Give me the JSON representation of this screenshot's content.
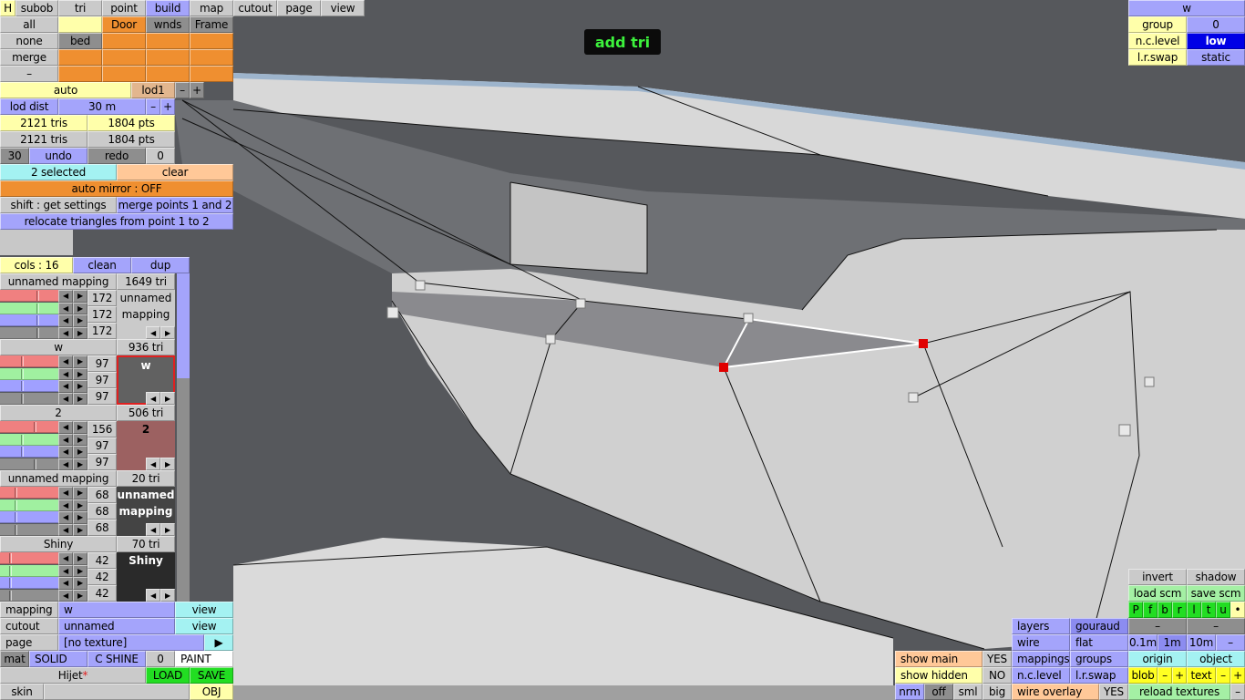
{
  "status_label": "add tri",
  "tabs": {
    "h": "H",
    "subob": "subob",
    "tri": "tri",
    "point": "point",
    "build": "build",
    "map": "map",
    "cutout": "cutout",
    "page": "page",
    "view": "view"
  },
  "groups": {
    "all": "all",
    "none": "none",
    "merge": "merge",
    "minus": "–",
    "door": "Door",
    "wnds": "wnds",
    "frame": "Frame",
    "bed": "bed"
  },
  "lod": {
    "auto": "auto",
    "level": "lod1",
    "minus": "–",
    "plus": "+",
    "dist_label": "lod dist",
    "dist_value": "30 m"
  },
  "stats": {
    "tris_a": "2121 tris",
    "pts_a": "1804 pts",
    "tris_b": "2121 tris",
    "pts_b": "1804 pts"
  },
  "history": {
    "undo_count": "30",
    "undo": "undo",
    "redo": "redo",
    "redo_count": "0"
  },
  "selection": {
    "selected": "2 selected",
    "clear": "clear",
    "auto_mirror": "auto mirror : OFF",
    "shift_hint": "shift : get settings",
    "merge_points": "merge points 1 and 2",
    "relocate": "relocate triangles from point 1 to 2"
  },
  "mappings_panel": {
    "cols": "cols : 16",
    "clean": "clean",
    "dup": "dup",
    "items": [
      {
        "name": "unnamed mapping",
        "tris": "1649 tri",
        "values": [
          "172",
          "172",
          "172"
        ],
        "rgb": [
          172,
          172,
          172
        ],
        "preview_line1": "unnamed",
        "preview_line2": "mapping",
        "preview_color": "#cacaca",
        "preview_text": "#000"
      },
      {
        "name": "w",
        "tris": "936 tri",
        "values": [
          "97",
          "97",
          "97"
        ],
        "rgb": [
          97,
          97,
          97
        ],
        "preview_line1": "w",
        "preview_line2": "",
        "preview_color": "#616161",
        "preview_text": "#fff"
      },
      {
        "name": "2",
        "tris": "506 tri",
        "values": [
          "156",
          "97",
          "97"
        ],
        "rgb": [
          156,
          97,
          97
        ],
        "preview_line1": "2",
        "preview_line2": "",
        "preview_color": "#9c6161",
        "preview_text": "#000"
      },
      {
        "name": "unnamed mapping",
        "tris": "20 tri",
        "values": [
          "68",
          "68",
          "68"
        ],
        "rgb": [
          68,
          68,
          68
        ],
        "preview_line1": "unnamed",
        "preview_line2": "mapping",
        "preview_color": "#444444",
        "preview_text": "#fff"
      },
      {
        "name": "Shiny",
        "tris": "70 tri",
        "values": [
          "42",
          "42",
          "42"
        ],
        "rgb": [
          42,
          42,
          42
        ],
        "preview_line1": "Shiny",
        "preview_line2": "",
        "preview_color": "#2a2a2a",
        "preview_text": "#fff"
      }
    ]
  },
  "bottom_left": {
    "mapping": "mapping",
    "mapping_value": "w",
    "view": "view",
    "cutout": "cutout",
    "cutout_value": "unnamed",
    "view2": "view",
    "page": "page",
    "page_value": "[no texture]",
    "page_arrow": "▶",
    "mat": "mat",
    "solid": "SOLID",
    "c_shine": "C SHINE",
    "zero": "0",
    "paint": "PAINT",
    "model": "Hijet",
    "modified": "*",
    "load": "LOAD",
    "save": "SAVE",
    "skin": "skin",
    "obj": "OBJ"
  },
  "top_right": {
    "title": "w",
    "group": "group",
    "group_value": "0",
    "nc_level": "n.c.level",
    "nc_value": "low",
    "lr_swap": "l.r.swap",
    "lr_value": "static"
  },
  "display": {
    "show_main": "show main",
    "show_main_value": "YES",
    "show_hidden": "show hidden",
    "show_hidden_value": "NO",
    "nrm": "nrm",
    "off": "off",
    "sml": "sml",
    "big": "big",
    "layers": "layers",
    "gouraud": "gouraud",
    "wire": "wire",
    "flat": "flat",
    "mappings": "mappings",
    "groups": "groups",
    "nc_level": "n.c.level",
    "lr_swap": "l.r.swap",
    "wire_overlay": "wire overlay",
    "wire_overlay_value": "YES"
  },
  "tools": {
    "invert": "invert",
    "shadow": "shadow",
    "load_scm": "load scm",
    "save_scm": "save scm",
    "views": [
      "P",
      "f",
      "b",
      "r",
      "l",
      "t",
      "u",
      "•"
    ],
    "dash": "–",
    "grid": [
      "0.1m",
      "1m",
      "10m",
      "–"
    ],
    "origin": "origin",
    "object": "object",
    "blob": "blob",
    "text": "text",
    "minus": "–",
    "plus": "+",
    "reload": "reload textures"
  }
}
